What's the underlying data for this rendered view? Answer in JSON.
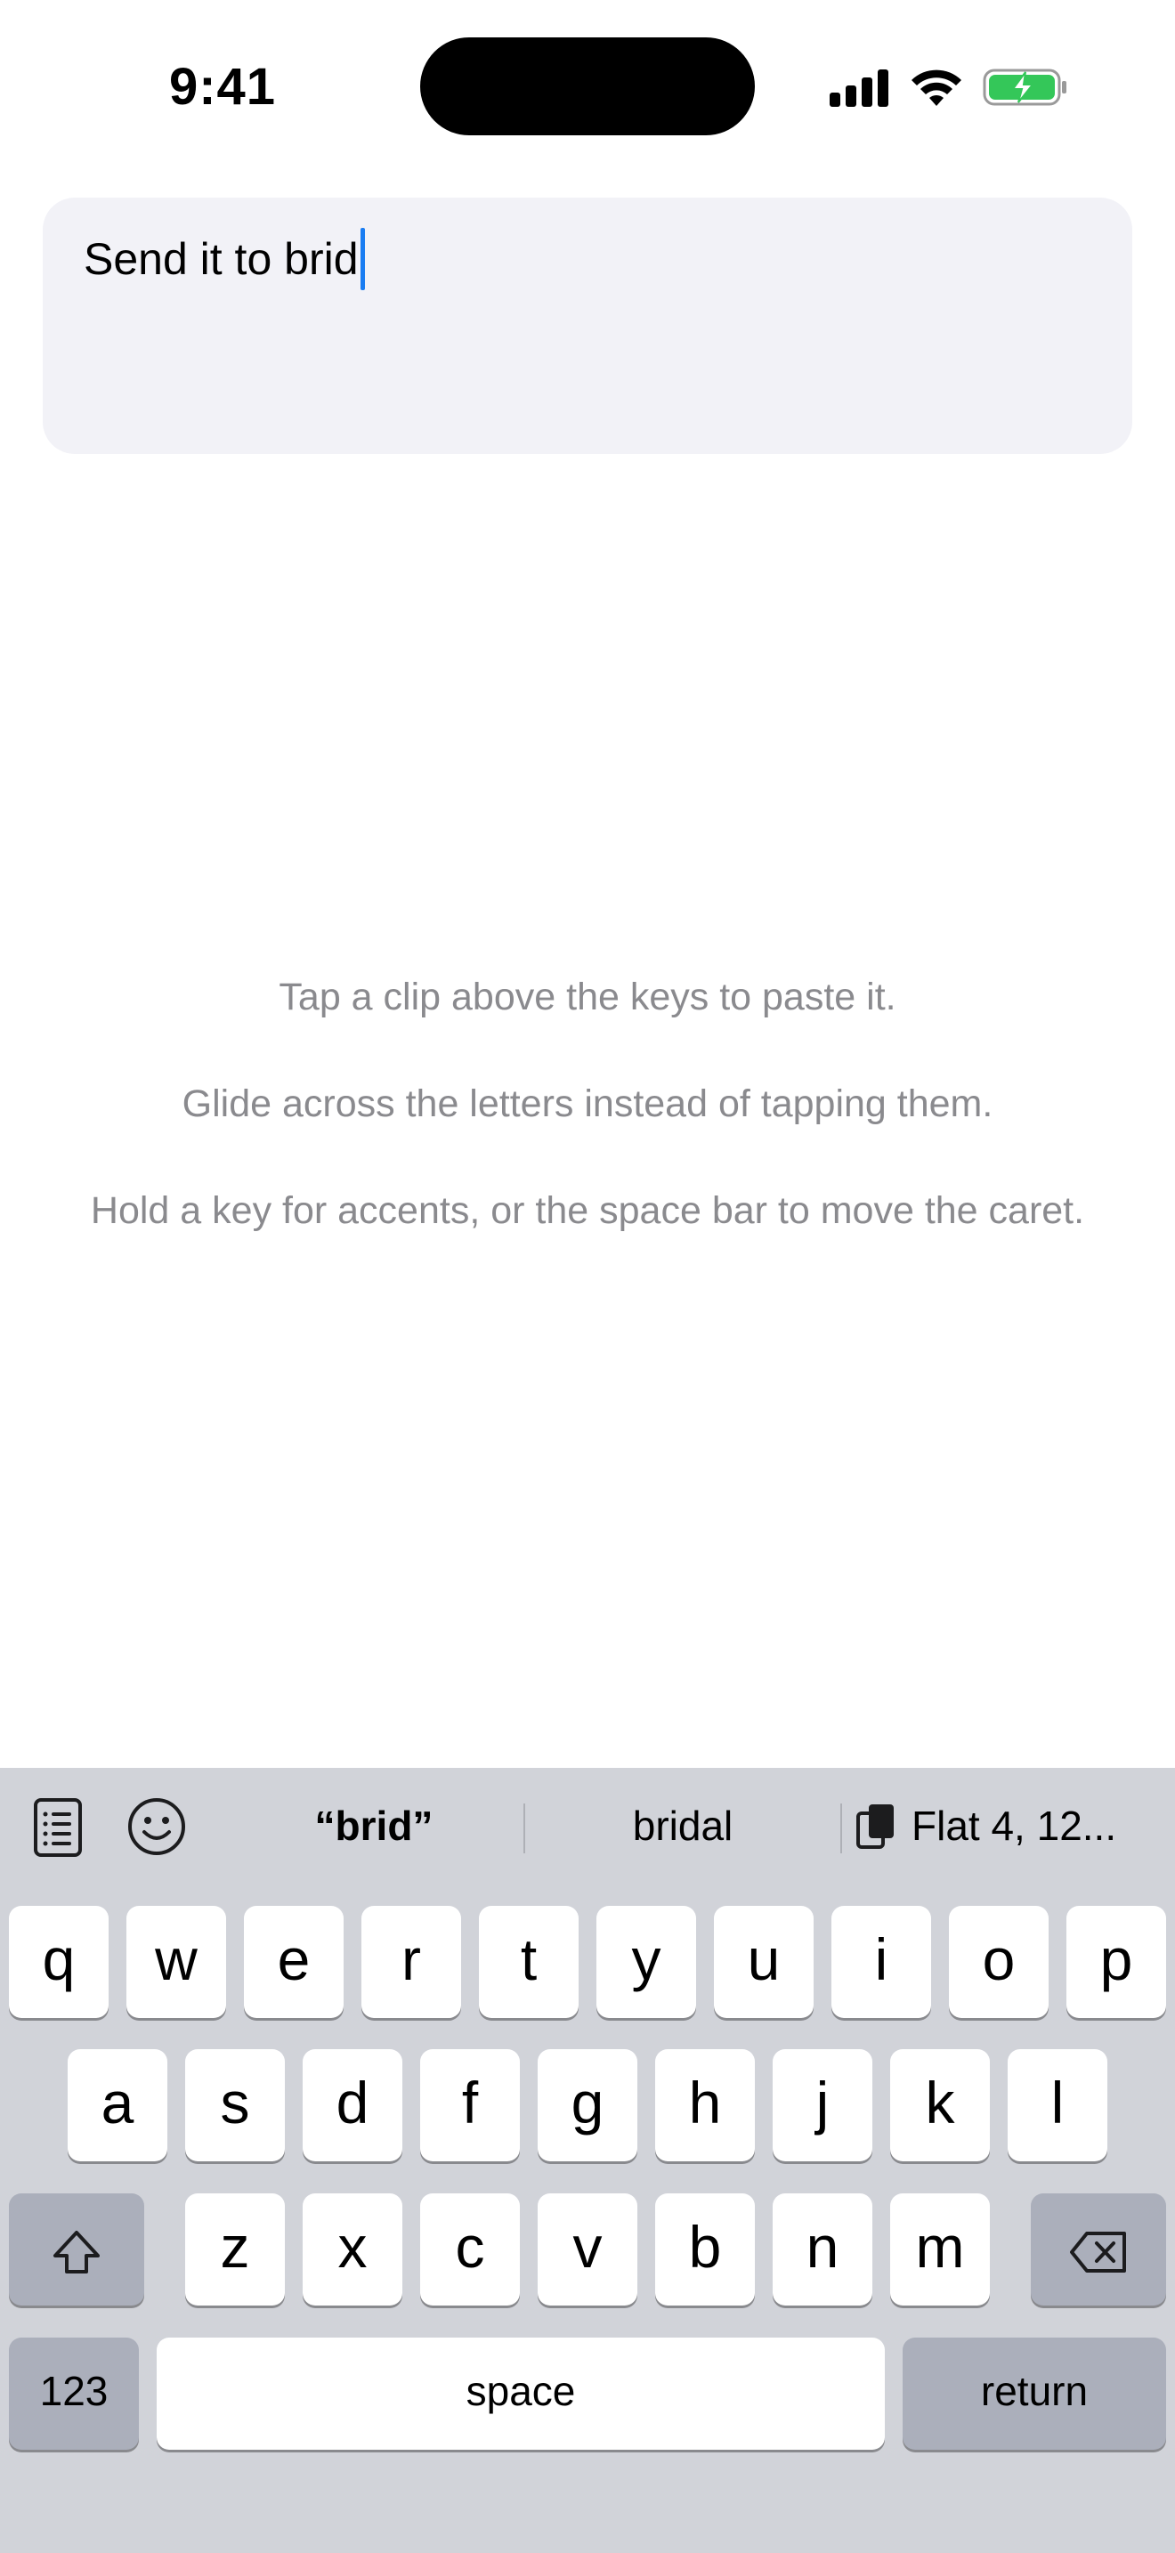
{
  "status_bar": {
    "time": "9:41",
    "icons": [
      "cellular-signal-icon",
      "wifi-icon",
      "battery-charging-icon"
    ],
    "battery_color": "#34c759"
  },
  "text_field": {
    "value": "Send it to brid",
    "caret_color": "#1a7df2"
  },
  "tips": [
    "Tap a clip above the keys to paste it.",
    "Glide across the letters instead of tapping them.",
    "Hold a key for accents, or the space bar to move the caret."
  ],
  "keyboard": {
    "toolbar_icons": [
      "clipboard-list-icon",
      "emoji-icon"
    ],
    "suggestions": {
      "literal": "“brid”",
      "word": "bridal",
      "clip": "Flat 4, 12...",
      "clip_icon": "clipboard-copy-icon"
    },
    "row1": [
      "q",
      "w",
      "e",
      "r",
      "t",
      "y",
      "u",
      "i",
      "o",
      "p"
    ],
    "row2": [
      "a",
      "s",
      "d",
      "f",
      "g",
      "h",
      "j",
      "k",
      "l"
    ],
    "row3": [
      "z",
      "x",
      "c",
      "v",
      "b",
      "n",
      "m"
    ],
    "shift_icon": "shift-icon",
    "delete_icon": "delete-icon",
    "numbers_label": "123",
    "space_label": "space",
    "return_label": "return"
  }
}
